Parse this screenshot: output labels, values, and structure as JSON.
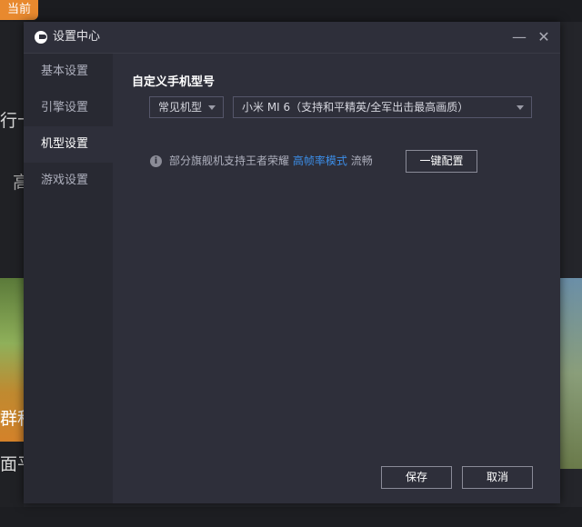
{
  "background": {
    "badge": "当前",
    "text1": "行卡",
    "text2": "高",
    "text3": "群科",
    "text4": "面平"
  },
  "dialog": {
    "title": "设置中心",
    "min_glyph": "—",
    "close_glyph": "✕"
  },
  "sidebar": {
    "items": [
      {
        "label": "基本设置"
      },
      {
        "label": "引擎设置"
      },
      {
        "label": "机型设置"
      },
      {
        "label": "游戏设置"
      }
    ]
  },
  "main": {
    "section_title": "自定义手机型号",
    "model_type_select": {
      "value": "常见机型"
    },
    "model_select": {
      "value": "小米 MI 6（支持和平精英/全军出击最高画质）"
    },
    "tip_text": "部分旗舰机支持王者荣耀",
    "tip_link": "高帧率模式",
    "tip_suffix": "流畅",
    "one_click_button": "一键配置",
    "info_glyph": "i"
  },
  "footer": {
    "save_label": "保存",
    "cancel_label": "取消"
  },
  "colors": {
    "accent_link": "#3c8ee8",
    "badge": "#e8892e",
    "dialog_bg": "#2e2f3a",
    "sidebar_bg": "#282932"
  }
}
